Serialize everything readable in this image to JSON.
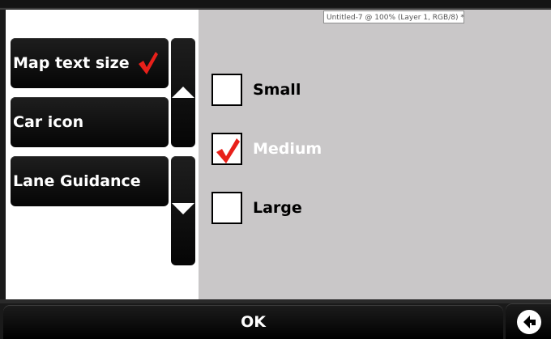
{
  "tooltip": {
    "text": "Untitled-7 @ 100% (Layer 1, RGB/8) *"
  },
  "menu": {
    "items": [
      {
        "label": "Map text size",
        "selected": true
      },
      {
        "label": "Car icon",
        "selected": false
      },
      {
        "label": "Lane Guidance",
        "selected": false
      }
    ],
    "scroll_up_icon": "triangle-up-icon",
    "scroll_down_icon": "triangle-down-icon"
  },
  "options": [
    {
      "label": "Small",
      "checked": false
    },
    {
      "label": "Medium",
      "checked": true
    },
    {
      "label": "Large",
      "checked": false
    }
  ],
  "footer": {
    "ok_label": "OK",
    "back_icon": "back-arrow-icon"
  },
  "colors": {
    "check_red": "#e8201a",
    "panel_gray": "#c9c7c8",
    "button_black": "#0a0a0a"
  }
}
